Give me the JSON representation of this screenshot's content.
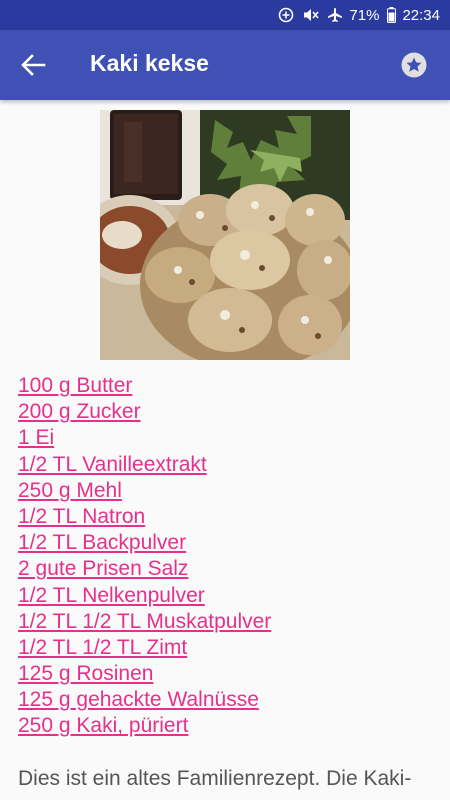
{
  "status_bar": {
    "battery": "71%",
    "time": "22:34"
  },
  "header": {
    "title": "Kaki kekse"
  },
  "colors": {
    "status_bar": "#2b3a9e",
    "app_bar": "#3f51b5",
    "link": "#e6318c",
    "body_text": "#555555"
  },
  "icons": {
    "back": "arrow-left-icon",
    "favorite": "star-icon"
  },
  "ingredients": [
    "100 g Butter",
    "200 g Zucker",
    "1 Ei",
    "1/2 TL Vanilleextrakt",
    "250 g Mehl",
    "1/2 TL Natron",
    "1/2 TL Backpulver",
    "2 gute Prisen Salz",
    "1/2 TL Nelkenpulver",
    "1/2 TL 1/2 TL Muskatpulver",
    "1/2 TL 1/2 TL Zimt",
    "125 g Rosinen",
    "125 g gehackte Walnüsse",
    "250 g Kaki, püriert"
  ],
  "description": "Dies ist ein altes Familienrezept. Die Kaki-"
}
